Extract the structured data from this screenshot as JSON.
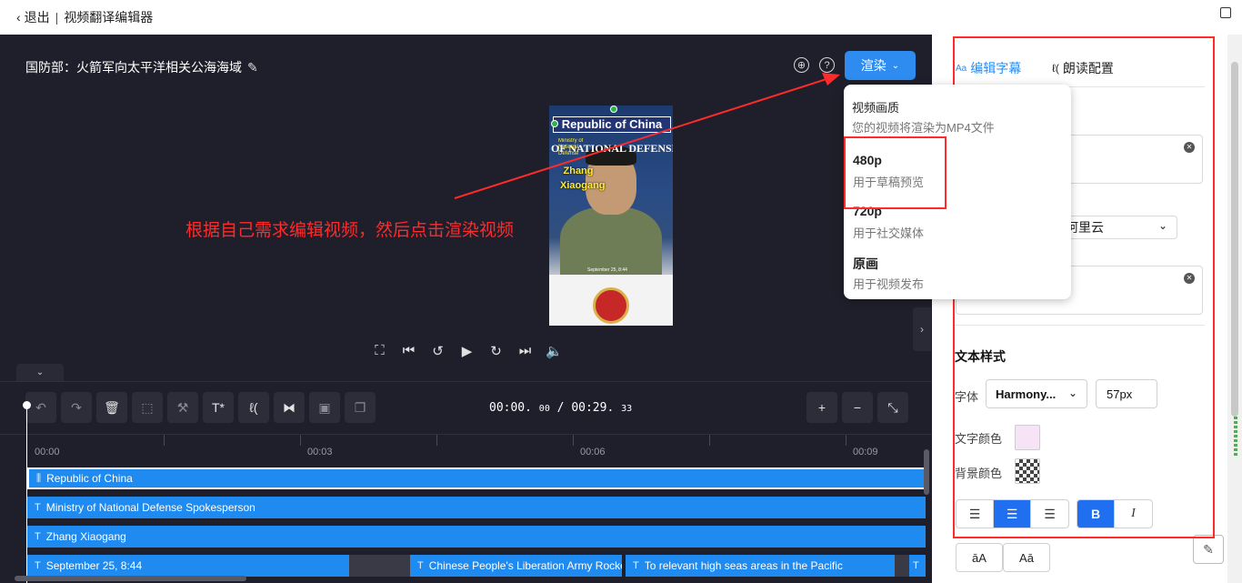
{
  "topbar": {
    "back_label": "退出",
    "separator": "|",
    "app_title": "视频翻译编辑器"
  },
  "editor": {
    "project_title": "国防部：火箭军向太平洋相关公海海域",
    "render_label": "渲染",
    "annotation": "根据自己需求编辑视频，然后点击渲染视频"
  },
  "video_overlay": {
    "headline": "Republic of China",
    "subtitle": "OF NATIONAL DEFENSE",
    "ministry": "Ministry of National Defense Spokesperson",
    "name": "Zhang Xiaogang",
    "date": "September 25, 8:44"
  },
  "render_menu": {
    "heading": "视频画质",
    "subheading": "您的视频将渲染为MP4文件",
    "options": [
      {
        "name": "480p",
        "desc": "用于草稿预览"
      },
      {
        "name": "720p",
        "desc": "用于社交媒体"
      },
      {
        "name": "原画",
        "desc": "用于视频发布"
      }
    ]
  },
  "timeline": {
    "current": "00:00.",
    "current_ms": "00",
    "total": "/ 00:29.",
    "total_ms": "33",
    "ticks": [
      "00:00",
      "00:03",
      "00:06",
      "00:09"
    ],
    "tracks": [
      "Republic of China",
      "Ministry of National Defense Spokesperson",
      "Zhang Xiaogang",
      "September 25, 8:44",
      "Chinese People's Liberation Army Rocket Force",
      "To relevant high seas areas in the Pacific"
    ]
  },
  "panel": {
    "tab_edit": "编辑字幕",
    "tab_read": "朗读配置",
    "voice_provider": "阿里云",
    "text_style_title": "文本样式",
    "font_label": "字体",
    "font_value": "Harmony...",
    "font_size": "57px",
    "text_color_label": "文字颜色",
    "bg_color_label": "背景颜色",
    "text_color": "#f6e3f6",
    "case_upper": "āA",
    "case_lower": "Aā"
  }
}
